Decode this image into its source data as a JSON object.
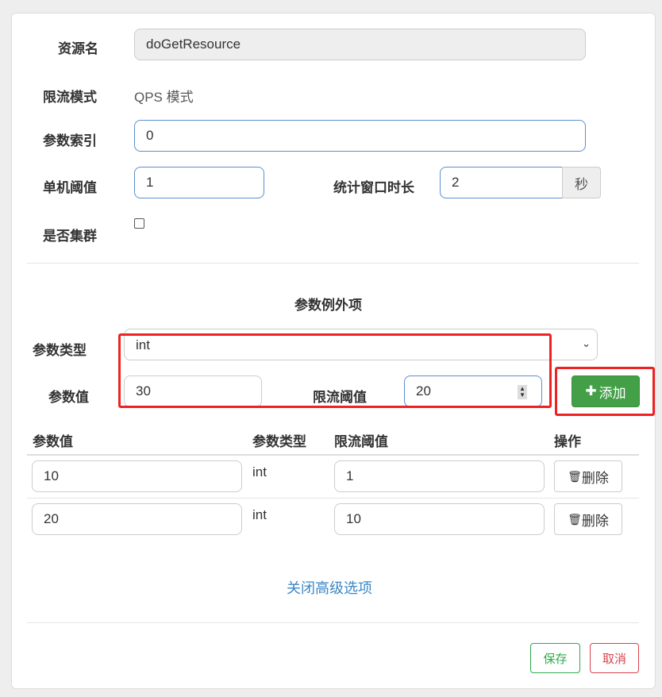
{
  "form": {
    "resource_label": "资源名",
    "resource_value": "doGetResource",
    "mode_label": "限流模式",
    "mode_value": "QPS 模式",
    "index_label": "参数索引",
    "index_value": "0",
    "threshold_label": "单机阈值",
    "threshold_value": "1",
    "window_label": "统计窗口时长",
    "window_value": "2",
    "window_unit": "秒",
    "cluster_label": "是否集群",
    "cluster_checked": false
  },
  "exceptions": {
    "title": "参数例外项",
    "type_label": "参数类型",
    "type_value": "int",
    "value_label": "参数值",
    "value_value": "30",
    "limit_label": "限流阈值",
    "limit_value": "20",
    "add_label": "添加",
    "columns": [
      "参数值",
      "参数类型",
      "限流阈值",
      "操作"
    ],
    "rows": [
      {
        "value": "10",
        "type": "int",
        "limit": "1",
        "action": "删除"
      },
      {
        "value": "20",
        "type": "int",
        "limit": "10",
        "action": "删除"
      }
    ]
  },
  "close_advanced": "关闭高级选项",
  "footer": {
    "save": "保存",
    "cancel": "取消"
  },
  "colors": {
    "highlight": "#ee2222",
    "success": "#43a047",
    "link": "#3a87c8",
    "danger": "#d9434e"
  }
}
